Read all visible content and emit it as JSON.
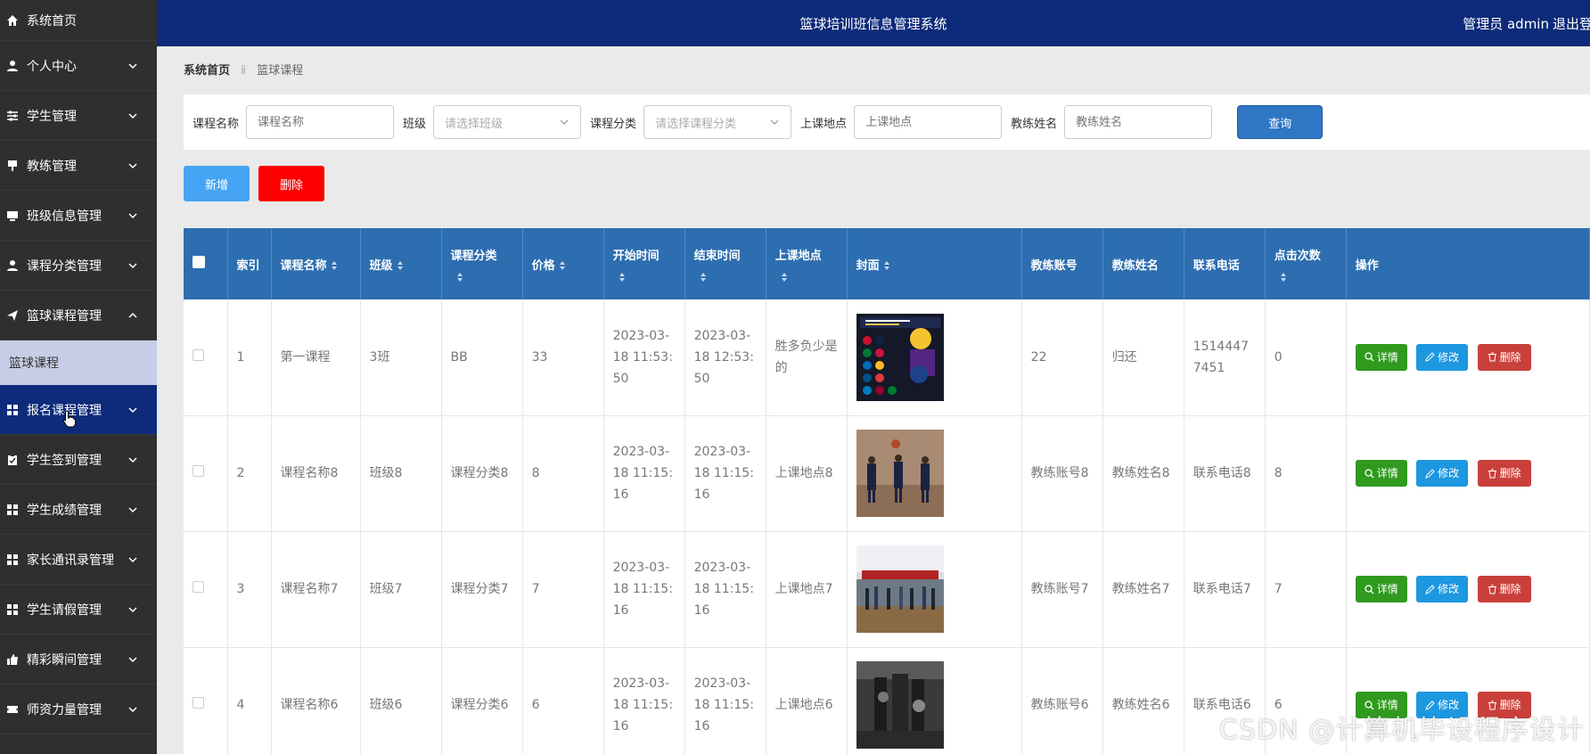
{
  "header": {
    "title": "篮球培训班信息管理系统",
    "admin": "管理员 admin",
    "logout": "退出登录"
  },
  "sidebar": {
    "items": [
      {
        "label": "系统首页",
        "icon": "home-icon"
      },
      {
        "label": "个人中心",
        "icon": "user-icon"
      },
      {
        "label": "学生管理",
        "icon": "sliders-icon"
      },
      {
        "label": "教练管理",
        "icon": "pin-icon"
      },
      {
        "label": "班级信息管理",
        "icon": "monitor-icon"
      },
      {
        "label": "课程分类管理",
        "icon": "user-icon"
      },
      {
        "label": "篮球课程管理",
        "icon": "send-icon"
      },
      {
        "label": "报名课程管理",
        "icon": "grid-icon"
      },
      {
        "label": "学生签到管理",
        "icon": "clipboard-icon"
      },
      {
        "label": "学生成绩管理",
        "icon": "grid-icon"
      },
      {
        "label": "家长通讯录管理",
        "icon": "grid-icon"
      },
      {
        "label": "学生请假管理",
        "icon": "grid-icon"
      },
      {
        "label": "精彩瞬间管理",
        "icon": "thumbs-up-icon"
      },
      {
        "label": "师资力量管理",
        "icon": "ticket-icon"
      }
    ],
    "sub_item": "篮球课程"
  },
  "breadcrumb": {
    "home": "系统首页",
    "separator": "ⅱ",
    "current": "篮球课程"
  },
  "search": {
    "course_name_label": "课程名称",
    "course_name_placeholder": "课程名称",
    "class_label": "班级",
    "class_placeholder": "请选择班级",
    "category_label": "课程分类",
    "category_placeholder": "请选择课程分类",
    "location_label": "上课地点",
    "location_placeholder": "上课地点",
    "coach_label": "教练姓名",
    "coach_placeholder": "教练姓名",
    "query_button": "查询"
  },
  "actions": {
    "add": "新增",
    "delete": "删除"
  },
  "table": {
    "headers": [
      "索引",
      "课程名称",
      "班级",
      "课程分类",
      "价格",
      "开始时间",
      "结束时间",
      "上课地点",
      "封面",
      "教练账号",
      "教练姓名",
      "联系电话",
      "点击次数",
      "操作"
    ],
    "row_buttons": {
      "detail": "详情",
      "edit": "修改",
      "remove": "删除"
    },
    "rows": [
      {
        "index": "1",
        "name": "第一课程",
        "class": "3班",
        "category": "BB",
        "price": "33",
        "start": "2023-03-18 11:53:50",
        "end": "2023-03-18 12:53:50",
        "location": "胜多负少是的",
        "cover": "cover-poster",
        "coach_account": "22",
        "coach_name": "归还",
        "phone": "15144477451",
        "clicks": "0"
      },
      {
        "index": "2",
        "name": "课程名称8",
        "class": "班级8",
        "category": "课程分类8",
        "price": "8",
        "start": "2023-03-18 11:15:16",
        "end": "2023-03-18 11:15:16",
        "location": "上课地点8",
        "cover": "cover-players",
        "coach_account": "教练账号8",
        "coach_name": "教练姓名8",
        "phone": "联系电话8",
        "clicks": "8"
      },
      {
        "index": "3",
        "name": "课程名称7",
        "class": "班级7",
        "category": "课程分类7",
        "price": "7",
        "start": "2023-03-18 11:15:16",
        "end": "2023-03-18 11:15:16",
        "location": "上课地点7",
        "cover": "cover-gym",
        "coach_account": "教练账号7",
        "coach_name": "教练姓名7",
        "phone": "联系电话7",
        "clicks": "7"
      },
      {
        "index": "4",
        "name": "课程名称6",
        "class": "班级6",
        "category": "课程分类6",
        "price": "6",
        "start": "2023-03-18 11:15:16",
        "end": "2023-03-18 11:15:16",
        "location": "上课地点6",
        "cover": "cover-dark",
        "coach_account": "教练账号6",
        "coach_name": "教练姓名6",
        "phone": "联系电话6",
        "clicks": "6"
      }
    ]
  },
  "watermark": "CSDN @计算机毕设程序设计",
  "colors": {
    "header": "#0d2b7a",
    "sidebar": "#2f2f2f",
    "table_header": "#2c6eb0",
    "detail": "#2f9a1e",
    "edit": "#1d97e0",
    "remove": "#c9403a",
    "add": "#46a4f5",
    "delete": "#ff0000"
  }
}
